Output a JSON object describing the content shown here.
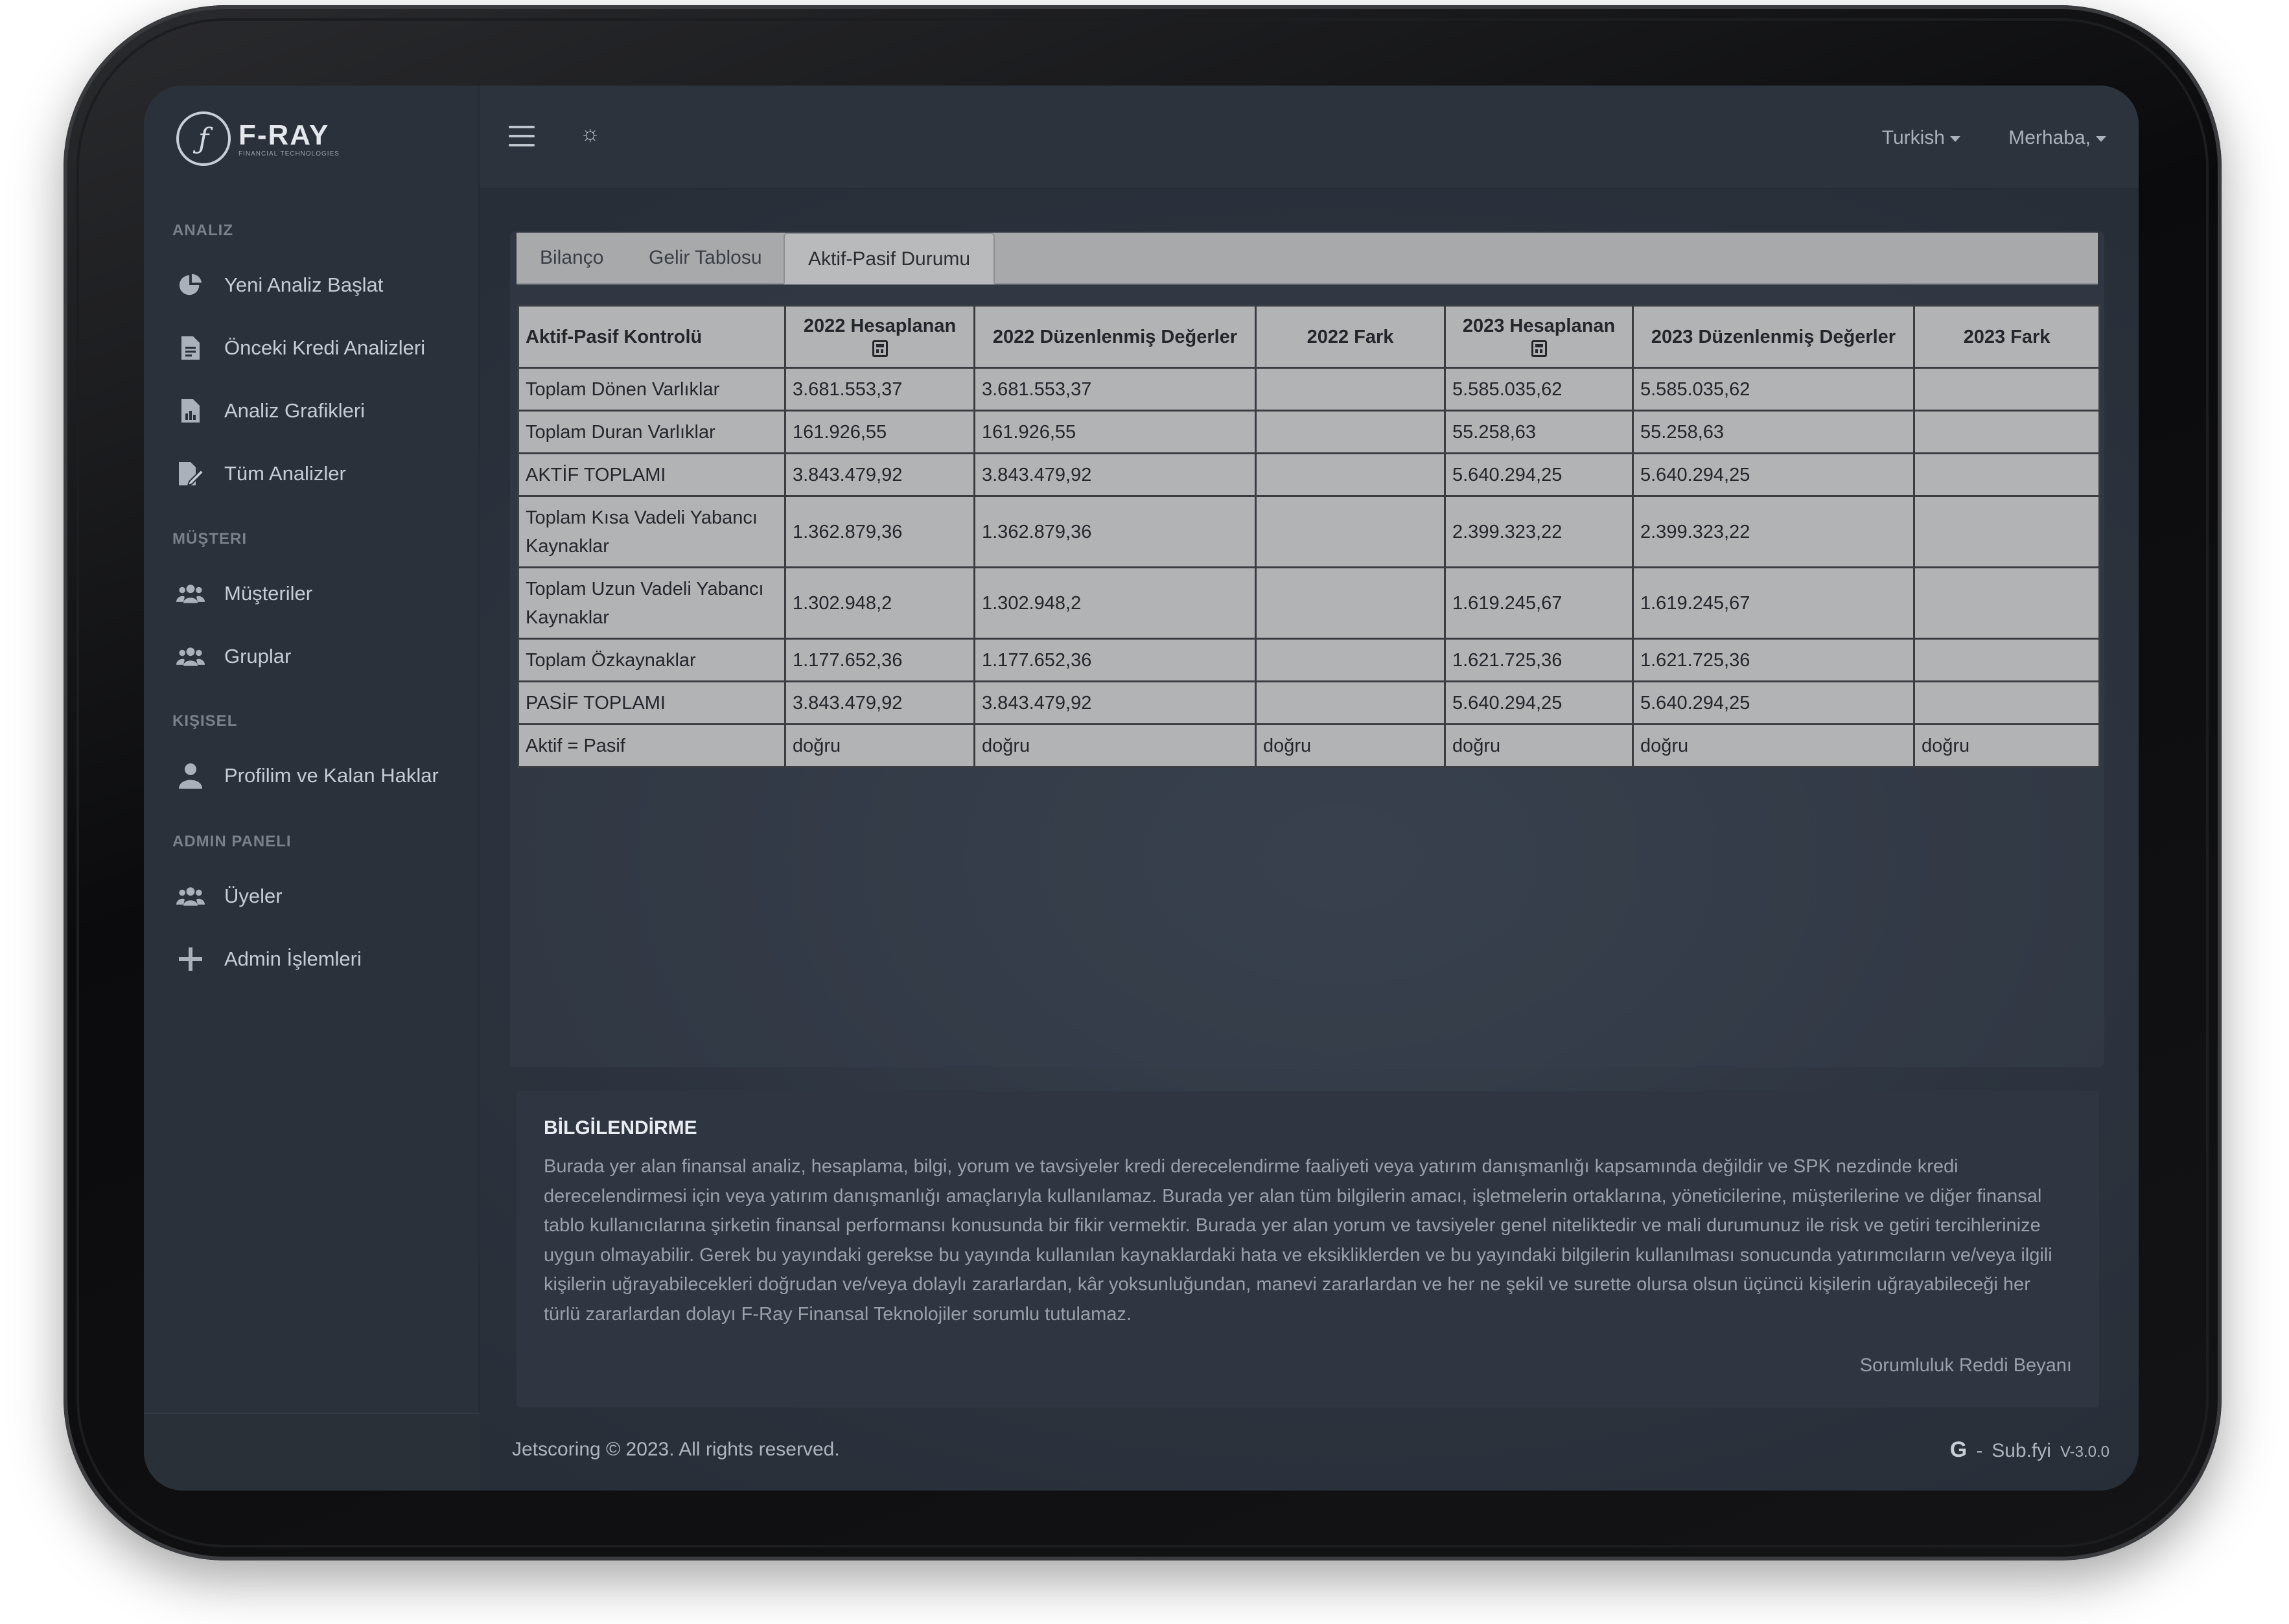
{
  "brand": {
    "name": "F-RAY",
    "sub": "FINANCIAL TECHNOLOGIES",
    "logo_glyph": "ƒ"
  },
  "sidebar": {
    "sections": [
      {
        "label": "ANALIZ"
      },
      {
        "label": "MÜŞTERI"
      },
      {
        "label": "KIŞISEL"
      },
      {
        "label": "ADMIN PANELI"
      }
    ],
    "items": [
      {
        "label": "Yeni Analiz Başlat",
        "icon": "pie-chart-icon"
      },
      {
        "label": "Önceki Kredi Analizleri",
        "icon": "document-icon"
      },
      {
        "label": "Analiz Grafikleri",
        "icon": "chart-document-icon"
      },
      {
        "label": "Tüm Analizler",
        "icon": "edit-document-icon"
      },
      {
        "label": "Müşteriler",
        "icon": "users-icon"
      },
      {
        "label": "Gruplar",
        "icon": "users-icon"
      },
      {
        "label": "Profilim ve Kalan Haklar",
        "icon": "user-icon"
      },
      {
        "label": "Üyeler",
        "icon": "users-icon"
      },
      {
        "label": "Admin İşlemleri",
        "icon": "plus-icon"
      }
    ]
  },
  "topbar": {
    "language": "Turkish",
    "greeting": "Merhaba,"
  },
  "tabs": [
    "Bilanço",
    "Gelir Tablosu",
    "Aktif-Pasif Durumu"
  ],
  "active_tab": "Aktif-Pasif Durumu",
  "table": {
    "headers": [
      "Aktif-Pasif Kontrolü",
      "2022 Hesaplanan",
      "2022 Düzenlenmiş Değerler",
      "2022 Fark",
      "2023 Hesaplanan",
      "2023 Düzenlenmiş Değerler",
      "2023 Fark"
    ],
    "rows": [
      [
        "Toplam Dönen Varlıklar",
        "3.681.553,37",
        "3.681.553,37",
        "",
        "5.585.035,62",
        "5.585.035,62",
        ""
      ],
      [
        "Toplam Duran Varlıklar",
        "161.926,55",
        "161.926,55",
        "",
        "55.258,63",
        "55.258,63",
        ""
      ],
      [
        "AKTİF TOPLAMI",
        "3.843.479,92",
        "3.843.479,92",
        "",
        "5.640.294,25",
        "5.640.294,25",
        ""
      ],
      [
        "Toplam Kısa Vadeli Yabancı Kaynaklar",
        "1.362.879,36",
        "1.362.879,36",
        "",
        "2.399.323,22",
        "2.399.323,22",
        ""
      ],
      [
        "Toplam Uzun Vadeli Yabancı Kaynaklar",
        "1.302.948,2",
        "1.302.948,2",
        "",
        "1.619.245,67",
        "1.619.245,67",
        ""
      ],
      [
        "Toplam Özkaynaklar",
        "1.177.652,36",
        "1.177.652,36",
        "",
        "1.621.725,36",
        "1.621.725,36",
        ""
      ],
      [
        "PASİF TOPLAMI",
        "3.843.479,92",
        "3.843.479,92",
        "",
        "5.640.294,25",
        "5.640.294,25",
        ""
      ],
      [
        "Aktif = Pasif",
        "doğru",
        "doğru",
        "doğru",
        "doğru",
        "doğru",
        "doğru"
      ]
    ]
  },
  "info": {
    "title": "BİLGİLENDİRME",
    "text": "Burada yer alan finansal analiz, hesaplama, bilgi, yorum ve tavsiyeler kredi derecelendirme faaliyeti veya yatırım danışmanlığı kapsamında değildir ve SPK nezdinde kredi derecelendirmesi için veya yatırım danışmanlığı amaçlarıyla kullanılamaz. Burada yer alan tüm bilgilerin amacı, işletmelerin ortaklarına, yöneticilerine, müşterilerine ve diğer finansal tablo kullanıcılarına şirketin finansal performansı konusunda bir fikir vermektir. Burada yer alan yorum ve tavsiyeler genel niteliktedir ve mali durumunuz ile risk ve getiri tercihlerinize uygun olmayabilir. Gerek bu yayındaki gerekse bu yayında kullanılan kaynaklardaki hata ve eksikliklerden ve bu yayındaki bilgilerin kullanılması sonucunda yatırımcıların ve/veya ilgili kişilerin uğrayabilecekleri doğrudan ve/veya dolaylı zararlardan, kâr yoksunluğundan, manevi zararlardan ve her ne şekil ve surette olursa olsun üçüncü kişilerin uğrayabileceği her türlü zararlardan dolayı F-Ray Finansal Teknolojiler sorumlu tutulamaz.",
    "link": "Sorumluluk Reddi Beyanı"
  },
  "footer": {
    "copyright": "Jetscoring © 2023. All rights reserved.",
    "g": "G",
    "dash": "-",
    "sub": "Sub.fyi",
    "version": "V-3.0.0"
  }
}
